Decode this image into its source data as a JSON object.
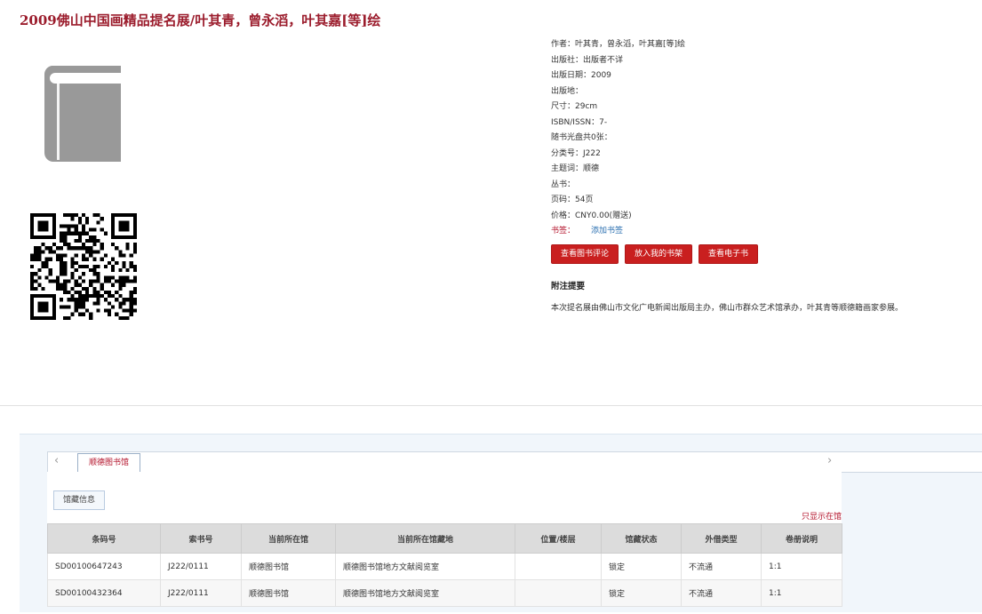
{
  "book": {
    "title": "2009佛山中国画精品提名展/叶其青，曾永滔，叶其嘉[等]绘"
  },
  "meta": {
    "author": "作者：叶其青，曾永滔，叶其嘉[等]绘",
    "publisher": "出版社：出版者不详",
    "pub_date": "出版日期：2009",
    "pub_place": "出版地：",
    "size": "尺寸：29cm",
    "isbn": "ISBN/ISSN：7-",
    "cd": "随书光盘共0张：",
    "classification": "分类号：J222",
    "subject": "主题词：顺德",
    "series": "丛书：",
    "pages": "页码：54页",
    "price": "价格：CNY0.00(赠送)",
    "bookmark_label": "书签：",
    "bookmark_link": "添加书签"
  },
  "buttons": {
    "review": "查看图书评论",
    "shelf": "放入我的书架",
    "ebook": "查看电子书"
  },
  "summary": {
    "title": "附注提要",
    "text": "本次提名展由佛山市文化广电新闻出版局主办，佛山市群众艺术馆承办，叶其青等顺德籍画家参展。"
  },
  "holdings": {
    "arrow_left": "‹",
    "arrow_right": "›",
    "library_tab": "顺德图书馆",
    "sub_tab": "馆藏信息",
    "only_link": "只显示在馆",
    "columns": [
      "条码号",
      "索书号",
      "当前所在馆",
      "当前所在馆藏地",
      "位置/楼层",
      "馆藏状态",
      "外借类型",
      "卷册说明"
    ],
    "rows": [
      [
        "SD00100647243",
        "J222/0111",
        "顺德图书馆",
        "顺德图书馆地方文献阅览室",
        "",
        "锁定",
        "不流通",
        "1:1"
      ],
      [
        "SD00100432364",
        "J222/0111",
        "顺德图书馆",
        "顺德图书馆地方文献阅览室",
        "",
        "锁定",
        "不流通",
        "1:1"
      ]
    ]
  },
  "colors": {
    "title": "#9b1c2c",
    "button": "#c91f1f",
    "link": "#2a6fb0",
    "icon_gray": "#999999"
  },
  "icons": {
    "cover": "book-icon",
    "qr": "qr-code"
  }
}
